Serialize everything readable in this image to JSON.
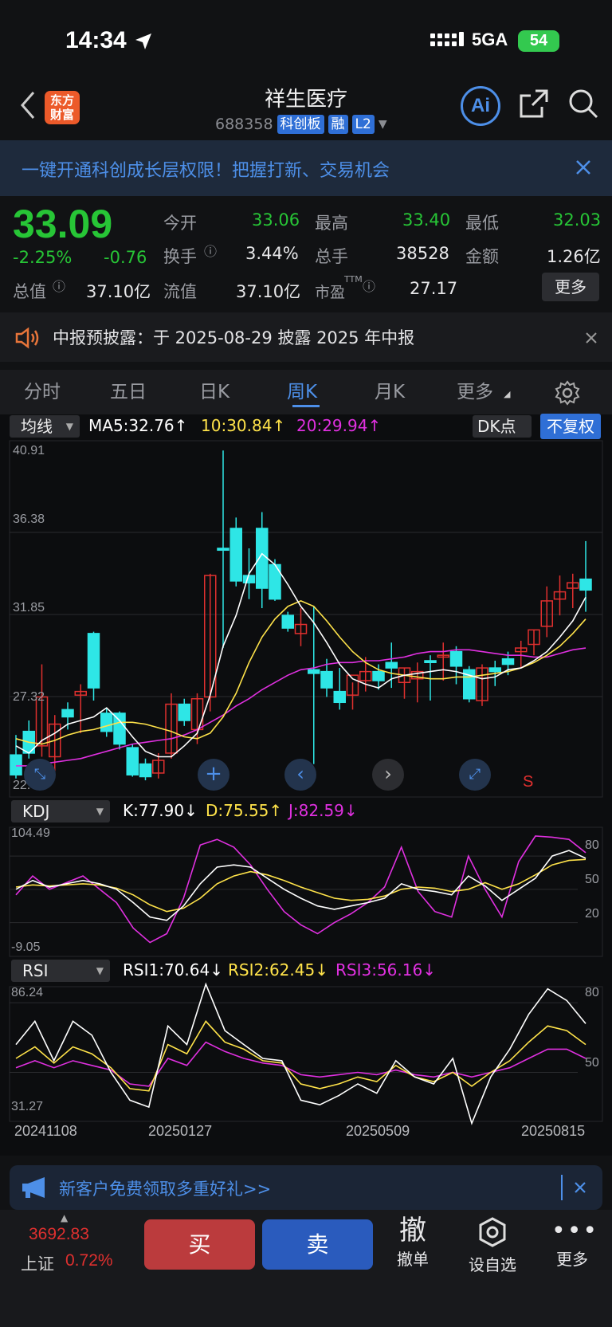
{
  "status": {
    "time": "14:34",
    "network": "5GA",
    "battery": "54"
  },
  "header": {
    "title": "祥生医疗",
    "code": "688358",
    "tags": [
      "科创板",
      "融",
      "L2"
    ],
    "logo_line1": "东方",
    "logo_line2": "财富",
    "ai_label": "Ai"
  },
  "banner": {
    "text": "一键开通科创成长层权限！把握打新、交易机会"
  },
  "quote": {
    "price": "33.09",
    "change_pct": "-2.25%",
    "change": "-0.76",
    "open_label": "今开",
    "open": "33.06",
    "high_label": "最高",
    "high": "33.40",
    "low_label": "最低",
    "low": "32.03",
    "turnover_label": "换手",
    "turnover": "3.44%",
    "volume_label": "总手",
    "volume": "38528",
    "amount_label": "金额",
    "amount": "1.26亿",
    "mktcap_label": "总值",
    "mktcap": "37.10亿",
    "float_label": "流值",
    "float": "37.10亿",
    "pe_label": "市盈",
    "pe_sup": "TTM",
    "pe": "27.17",
    "more": "更多"
  },
  "notice": {
    "text": "中报预披露：于 2025-08-29 披露 2025 年中报"
  },
  "tabs": [
    {
      "label": "分时"
    },
    {
      "label": "五日"
    },
    {
      "label": "日K"
    },
    {
      "label": "周K"
    },
    {
      "label": "月K"
    },
    {
      "label": "更多"
    }
  ],
  "main_chart": {
    "indicator": "均线",
    "ma5": "MA5:32.76",
    "ma5_arrow": "↑",
    "ma10": "10:30.84",
    "ma10_arrow": "↑",
    "ma20": "20:29.94",
    "ma20_arrow": "↑",
    "dk_label": "DK点",
    "adjust_label": "不复权",
    "yticks": [
      "40.91",
      "36.38",
      "31.85",
      "27.32",
      "22.79"
    ],
    "s_marker": "S"
  },
  "kdj": {
    "indicator": "KDJ",
    "k": "K:77.90",
    "k_arrow": "↓",
    "d": "D:75.55",
    "d_arrow": "↑",
    "j": "J:82.59",
    "j_arrow": "↓",
    "ymax": "104.49",
    "ymin": "-9.05",
    "levels": [
      "80",
      "50",
      "20"
    ]
  },
  "rsi": {
    "indicator": "RSI",
    "r1": "RSI1:70.64",
    "r1_arrow": "↓",
    "r2": "RSI2:62.45",
    "r2_arrow": "↓",
    "r3": "RSI3:56.16",
    "r3_arrow": "↓",
    "ymax": "86.24",
    "ymin": "31.27",
    "levels": [
      "80",
      "50"
    ]
  },
  "dates": [
    "20241108",
    "20250127",
    "20250509",
    "20250815"
  ],
  "colors": {
    "up": "#e0302f",
    "down": "#2ee6e6",
    "ma5": "#ffffff",
    "ma10": "#ffe34a",
    "ma20": "#e030e0",
    "accent": "#4d8fe8",
    "price_green": "#27c536"
  },
  "chart_data": {
    "type": "candlestick",
    "candles": [
      [
        24.1,
        25.2,
        22.8,
        23.0
      ],
      [
        25.4,
        26.0,
        23.9,
        24.2
      ],
      [
        24.6,
        29.1,
        24.0,
        27.3
      ],
      [
        24.0,
        26.3,
        22.9,
        25.8
      ],
      [
        26.6,
        27.0,
        25.5,
        26.2
      ],
      [
        27.4,
        28.0,
        25.3,
        27.6
      ],
      [
        30.8,
        30.9,
        27.1,
        27.8
      ],
      [
        26.4,
        26.7,
        25.1,
        25.4
      ],
      [
        26.4,
        26.5,
        24.4,
        24.7
      ],
      [
        24.5,
        24.7,
        22.9,
        23.0
      ],
      [
        23.6,
        23.9,
        22.7,
        22.9
      ],
      [
        23.1,
        24.2,
        22.8,
        23.8
      ],
      [
        24.2,
        27.5,
        23.9,
        26.9
      ],
      [
        26.9,
        27.2,
        25.7,
        26.0
      ],
      [
        25.5,
        27.5,
        24.7,
        27.2
      ],
      [
        27.3,
        34.1,
        26.5,
        34.0
      ],
      [
        35.5,
        40.9,
        30.0,
        35.4
      ],
      [
        36.6,
        37.2,
        33.4,
        33.7
      ],
      [
        34.0,
        35.5,
        32.7,
        33.6
      ],
      [
        36.6,
        37.5,
        32.2,
        33.3
      ],
      [
        34.6,
        34.9,
        32.6,
        32.7
      ],
      [
        31.8,
        32.0,
        30.9,
        31.1
      ],
      [
        30.8,
        32.2,
        30.1,
        31.3
      ],
      [
        28.8,
        32.3,
        23.6,
        28.6
      ],
      [
        28.7,
        29.4,
        27.3,
        27.8
      ],
      [
        27.6,
        28.9,
        26.6,
        27.0
      ],
      [
        27.4,
        28.1,
        26.6,
        28.5
      ],
      [
        28.2,
        29.5,
        27.6,
        28.7
      ],
      [
        28.7,
        29.1,
        27.7,
        28.2
      ],
      [
        29.2,
        30.3,
        27.8,
        28.9
      ],
      [
        28.1,
        28.9,
        27.2,
        28.9
      ],
      [
        28.3,
        29.2,
        27.0,
        28.7
      ],
      [
        29.3,
        29.6,
        27.1,
        29.2
      ],
      [
        29.5,
        30.3,
        28.2,
        29.6
      ],
      [
        29.8,
        30.1,
        28.0,
        29.0
      ],
      [
        28.8,
        29.0,
        27.0,
        27.2
      ],
      [
        27.1,
        29.1,
        26.8,
        28.9
      ],
      [
        28.9,
        29.3,
        27.9,
        28.7
      ],
      [
        29.4,
        29.8,
        28.5,
        29.1
      ],
      [
        29.8,
        30.4,
        28.9,
        30.0
      ],
      [
        30.2,
        31.0,
        29.6,
        31.0
      ],
      [
        31.2,
        33.4,
        30.6,
        32.6
      ],
      [
        32.7,
        34.0,
        31.8,
        33.1
      ],
      [
        33.3,
        34.1,
        32.2,
        33.6
      ],
      [
        33.8,
        35.9,
        32.0,
        33.2
      ]
    ],
    "candle_format": "[open, high, low, close]",
    "ma5": [
      24.6,
      24.2,
      24.9,
      25.3,
      25.8,
      26.0,
      26.2,
      26.7,
      26.0,
      25.1,
      24.3,
      24.0,
      24.0,
      24.6,
      25.3,
      27.4,
      30.1,
      31.8,
      34.1,
      35.2,
      34.6,
      33.5,
      32.3,
      31.4,
      30.3,
      29.1,
      28.3,
      28.0,
      27.8,
      28.3,
      28.5,
      28.6,
      28.7,
      28.8,
      28.7,
      28.5,
      28.3,
      28.4,
      28.8,
      28.9,
      29.3,
      29.8,
      30.6,
      31.5,
      32.8
    ],
    "ma10": [
      25.0,
      24.8,
      24.7,
      24.9,
      25.2,
      25.4,
      25.5,
      25.7,
      25.9,
      25.9,
      25.8,
      25.6,
      25.4,
      25.1,
      25.0,
      25.3,
      26.2,
      27.5,
      29.2,
      30.6,
      31.6,
      32.3,
      32.6,
      32.3,
      31.5,
      30.6,
      29.8,
      29.2,
      28.8,
      28.6,
      28.5,
      28.4,
      28.3,
      28.3,
      28.4,
      28.4,
      28.5,
      28.6,
      28.7,
      28.9,
      29.2,
      29.6,
      30.1,
      30.8,
      31.6
    ],
    "ma20": [
      23.5,
      23.5,
      23.6,
      23.7,
      23.8,
      23.9,
      24.1,
      24.3,
      24.5,
      24.7,
      24.8,
      24.9,
      25.0,
      25.2,
      25.5,
      25.9,
      26.3,
      26.8,
      27.2,
      27.7,
      28.1,
      28.5,
      28.8,
      28.9,
      29.1,
      29.2,
      29.2,
      29.3,
      29.3,
      29.4,
      29.5,
      29.7,
      29.8,
      29.8,
      29.9,
      29.9,
      29.8,
      29.7,
      29.6,
      29.6,
      29.5,
      29.5,
      29.7,
      29.9,
      30.0
    ],
    "kdj_k": [
      50,
      58,
      52,
      55,
      58,
      55,
      50,
      38,
      25,
      22,
      35,
      55,
      70,
      72,
      70,
      60,
      50,
      42,
      35,
      32,
      35,
      38,
      42,
      55,
      50,
      48,
      45,
      62,
      53,
      40,
      50,
      60,
      80,
      85,
      78
    ],
    "kdj_d": [
      52,
      54,
      53,
      54,
      55,
      54,
      51,
      45,
      36,
      30,
      33,
      42,
      55,
      62,
      66,
      63,
      58,
      52,
      47,
      42,
      40,
      41,
      44,
      50,
      52,
      51,
      48,
      50,
      56,
      50,
      55,
      63,
      72,
      76,
      77
    ],
    "kdj_j": [
      45,
      62,
      50,
      56,
      62,
      50,
      38,
      15,
      2,
      10,
      42,
      90,
      95,
      88,
      72,
      50,
      30,
      18,
      10,
      20,
      28,
      38,
      52,
      88,
      48,
      30,
      25,
      80,
      50,
      25,
      75,
      98,
      97,
      95,
      83
    ],
    "rsi1": [
      62,
      72,
      55,
      72,
      66,
      50,
      38,
      35,
      70,
      62,
      88,
      68,
      62,
      56,
      55,
      38,
      36,
      40,
      45,
      41,
      55,
      48,
      45,
      56,
      28,
      48,
      60,
      75,
      86,
      81,
      71
    ],
    "rsi2": [
      56,
      61,
      54,
      61,
      58,
      52,
      43,
      42,
      62,
      58,
      72,
      63,
      60,
      55,
      54,
      45,
      43,
      45,
      48,
      46,
      53,
      48,
      46,
      50,
      44,
      50,
      55,
      63,
      70,
      68,
      62
    ],
    "rsi3": [
      52,
      55,
      52,
      55,
      53,
      51,
      45,
      44,
      56,
      53,
      63,
      59,
      56,
      54,
      53,
      49,
      48,
      49,
      50,
      49,
      51,
      49,
      48,
      50,
      48,
      50,
      52,
      56,
      60,
      60,
      56
    ]
  },
  "ad": {
    "text": "新客户免费领取多重好礼>>"
  },
  "bottom": {
    "index_value": "3692.83",
    "index_name": "上证",
    "index_pct": "0.72%",
    "buy": "买",
    "sell": "卖",
    "cancel_big": "撤",
    "cancel": "撤单",
    "watch": "设自选",
    "more": "更多"
  }
}
